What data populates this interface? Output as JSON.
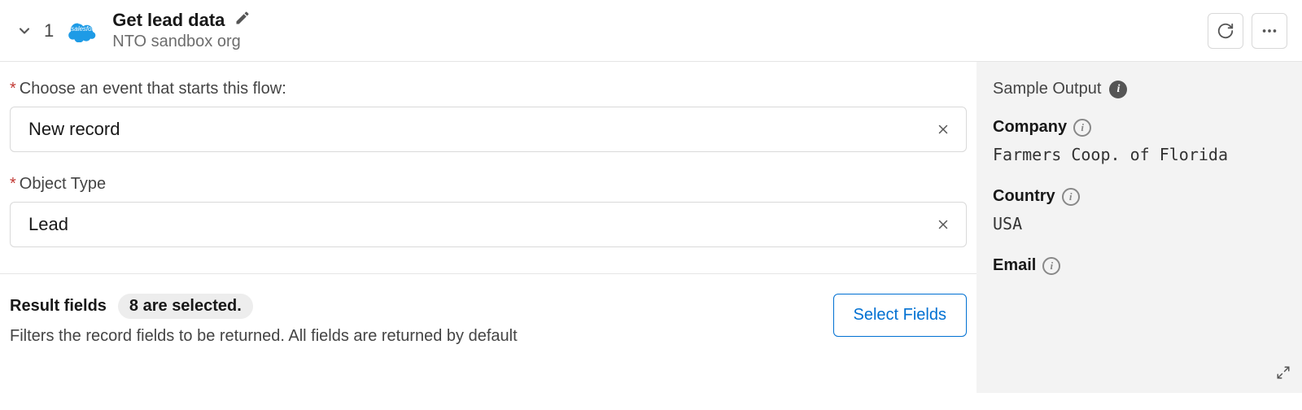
{
  "header": {
    "step_number": "1",
    "title": "Get lead data",
    "subtitle": "NTO sandbox org"
  },
  "form": {
    "event_label": "Choose an event that starts this flow:",
    "event_value": "New record",
    "object_label": "Object Type",
    "object_value": "Lead"
  },
  "result": {
    "heading": "Result fields",
    "count_text": "8 are selected.",
    "description": "Filters the record fields to be returned. All fields are returned by default",
    "select_button": "Select Fields"
  },
  "sample": {
    "header": "Sample Output",
    "fields": [
      {
        "label": "Company",
        "value": "Farmers Coop. of Florida"
      },
      {
        "label": "Country",
        "value": "USA"
      },
      {
        "label": "Email",
        "value": ""
      }
    ]
  }
}
